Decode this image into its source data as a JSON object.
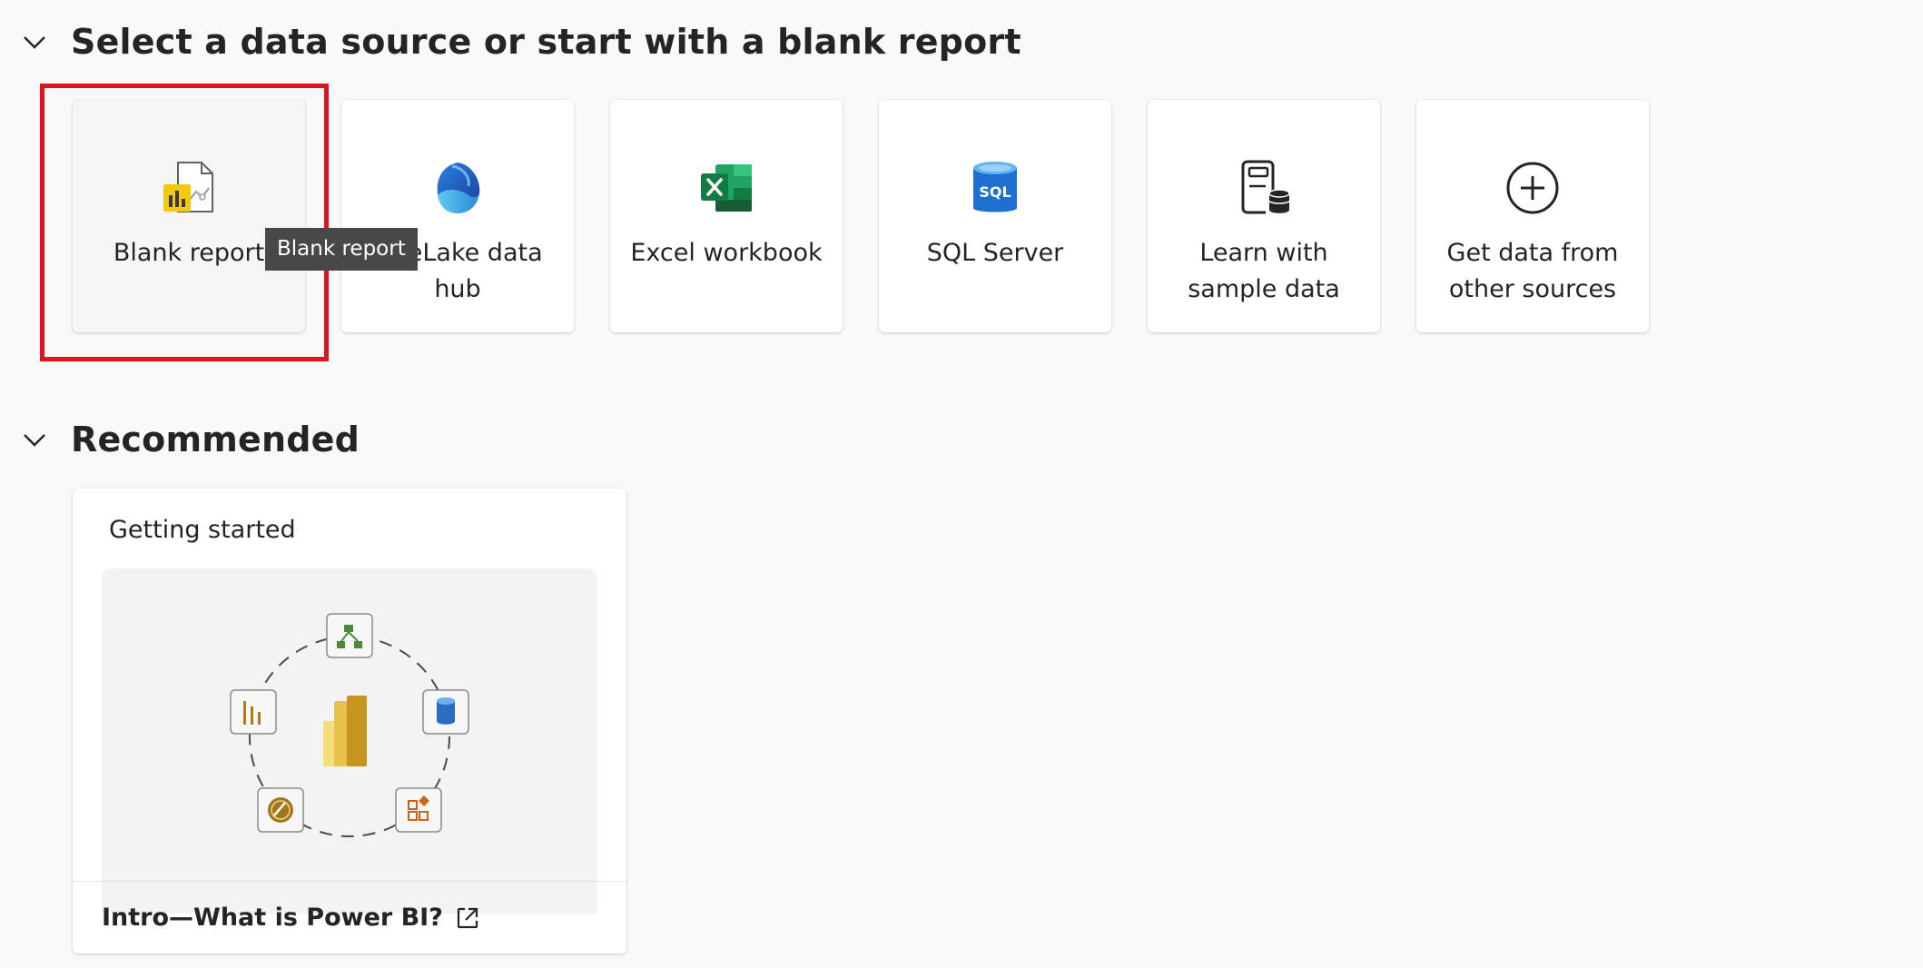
{
  "sections": {
    "data_source": {
      "title": "Select a data source or start with a blank report",
      "icon": "chevron-down-icon"
    },
    "recommended": {
      "title": "Recommended",
      "icon": "chevron-down-icon"
    }
  },
  "cards": [
    {
      "label": "Blank report",
      "icon": "blank-report-icon"
    },
    {
      "label": "OneLake data hub",
      "icon": "onelake-icon"
    },
    {
      "label": "Excel workbook",
      "icon": "excel-icon"
    },
    {
      "label": "SQL Server",
      "icon": "sql-server-icon"
    },
    {
      "label": "Learn with sample data",
      "icon": "sample-data-icon"
    },
    {
      "label": "Get data from other sources",
      "icon": "plus-circle-icon"
    }
  ],
  "tooltip": {
    "text": "Blank report"
  },
  "recommended_card": {
    "label": "Getting started",
    "link": "Intro—What is Power BI?",
    "link_icon": "external-link-icon",
    "image": "power-bi-overview-illustration"
  },
  "colors": {
    "highlight": "#e0121b",
    "tooltip_bg": "#484848",
    "background": "#f9f9f9"
  }
}
